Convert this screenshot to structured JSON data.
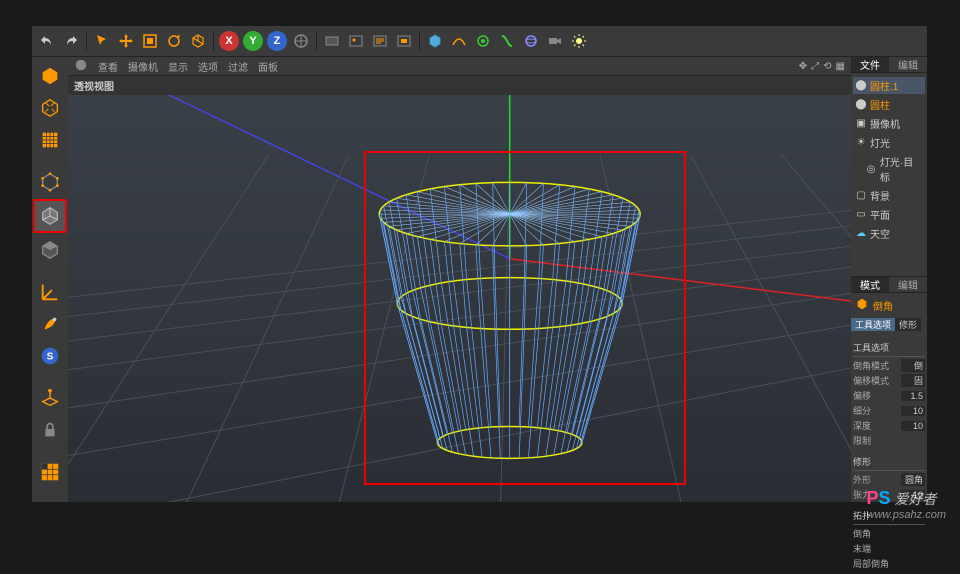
{
  "view": {
    "title": "透视视图",
    "menu": [
      "查看",
      "摄像机",
      "显示",
      "选项",
      "过滤",
      "面板"
    ]
  },
  "right": {
    "tabs": [
      "文件",
      "编辑"
    ],
    "tree": {
      "cylinder1": "圆柱.1",
      "cylinder": "圆柱",
      "camera": "摄像机",
      "light": "灯光",
      "lighttarget": "灯光·目标",
      "background": "背景",
      "plane": "平面",
      "sky": "天空"
    },
    "tabs2": [
      "模式",
      "编辑"
    ],
    "obj": "倒角",
    "ptabs": [
      "工具选项",
      "修形"
    ],
    "group1": "工具选项",
    "props": {
      "bevelmode_l": "倒角模式",
      "bevelmode_v": "倒",
      "offsetmode_l": "偏移模式",
      "offsetmode_v": "固",
      "offset_l": "偏移",
      "offset_v": "1.5",
      "subdiv_l": "细分",
      "subdiv_v": "10",
      "depth_l": "深度",
      "depth_v": "10",
      "limit_l": "限制",
      "limit_v": ""
    },
    "group2": "修形",
    "props2": {
      "shape_l": "外形",
      "shape_v": "圆角",
      "tension_l": "张力",
      "tension_v": "10"
    },
    "group3": "拓扑",
    "props3": {
      "corner_l": "倒角",
      "corner_v": "",
      "end_l": "末端",
      "end_v": "",
      "partial_l": "局部倒角",
      "partial_v": ""
    }
  },
  "wm": {
    "brand1": "P",
    "brand2": "S",
    "text": "爱好者",
    "url": "www.psahz.com"
  }
}
